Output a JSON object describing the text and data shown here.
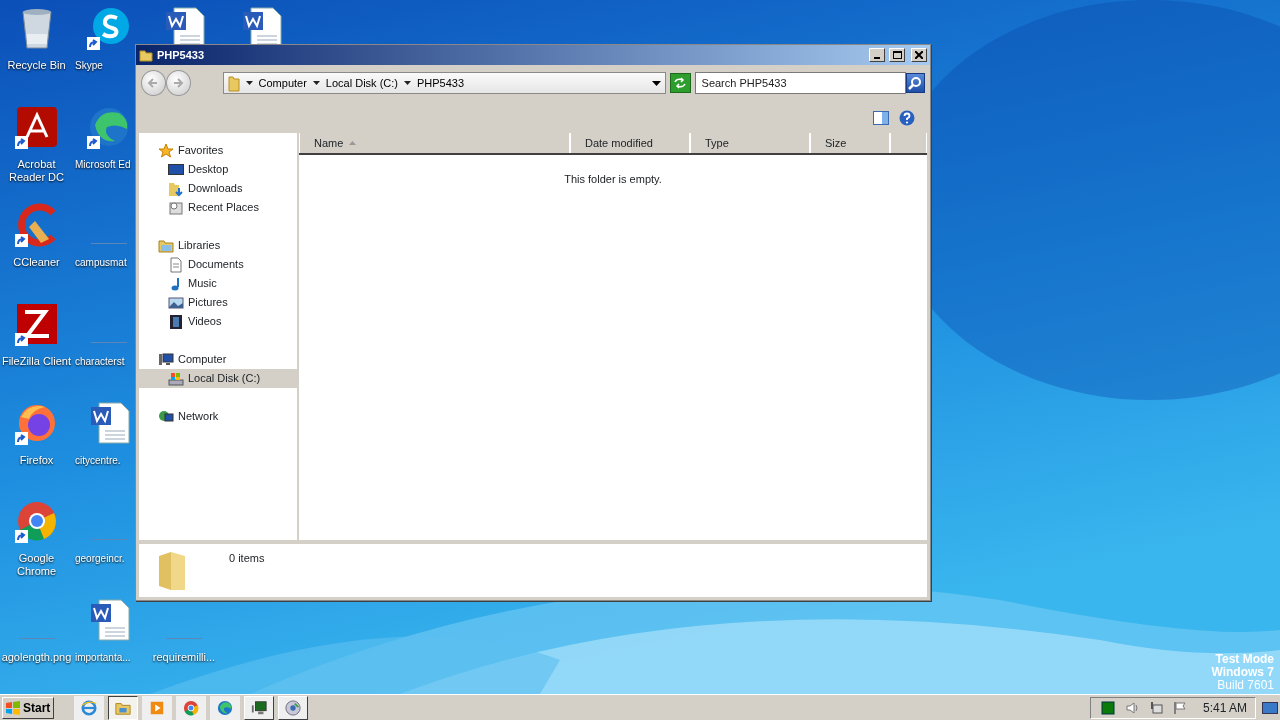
{
  "desktop": {
    "columns": [
      [
        {
          "label": "Recycle Bin",
          "kind": "recycle",
          "shortcut": false
        },
        {
          "label": "Acrobat Reader DC",
          "kind": "acrobat",
          "shortcut": true
        },
        {
          "label": "CCleaner",
          "kind": "ccleaner",
          "shortcut": true
        },
        {
          "label": "FileZilla Client",
          "kind": "filezilla",
          "shortcut": true
        },
        {
          "label": "Firefox",
          "kind": "firefox",
          "shortcut": true
        },
        {
          "label": "Google Chrome",
          "kind": "chrome",
          "shortcut": true
        },
        {
          "label": "agolength.png",
          "kind": "blank",
          "shortcut": false
        }
      ],
      [
        {
          "label": "Skype",
          "kind": "skype",
          "shortcut": true
        },
        {
          "label": "Microsoft Ed",
          "kind": "edge",
          "shortcut": true
        },
        {
          "label": "campusmat",
          "kind": "blank",
          "shortcut": false
        },
        {
          "label": "characterst",
          "kind": "blank",
          "shortcut": false
        },
        {
          "label": "citycentre.",
          "kind": "word",
          "shortcut": false
        },
        {
          "label": "georgeincr.",
          "kind": "blank",
          "shortcut": false
        },
        {
          "label": "importanta...",
          "kind": "word",
          "shortcut": false
        }
      ],
      [
        {
          "kind": "word",
          "shortcut": false
        },
        {
          "label": "requiremilli...",
          "kind": "blank",
          "shortcut": false
        }
      ],
      [
        {
          "kind": "word",
          "shortcut": false
        }
      ]
    ]
  },
  "os_notice": [
    {
      "text": "Test Mode",
      "bold": true
    },
    {
      "text": "Windows 7",
      "bold": true
    },
    {
      "text": "Build 7601",
      "bold": false
    }
  ],
  "window": {
    "title": "PHP5433",
    "breadcrumb": [
      "Computer",
      "Local Disk (C:)",
      "PHP5433"
    ],
    "search": {
      "placeholder": "Search PHP5433"
    },
    "nav_pane": [
      {
        "label": "Favorites",
        "kind": "star",
        "selected": false,
        "children": [
          {
            "label": "Desktop",
            "kind": "desktop",
            "selected": false
          },
          {
            "label": "Downloads",
            "kind": "downloads",
            "selected": false
          },
          {
            "label": "Recent Places",
            "kind": "recent",
            "selected": false
          }
        ]
      },
      {
        "label": "Libraries",
        "kind": "libraries",
        "selected": false,
        "children": [
          {
            "label": "Documents",
            "kind": "documents",
            "selected": false
          },
          {
            "label": "Music",
            "kind": "music",
            "selected": false
          },
          {
            "label": "Pictures",
            "kind": "pictures",
            "selected": false
          },
          {
            "label": "Videos",
            "kind": "videos",
            "selected": false
          }
        ]
      },
      {
        "label": "Computer",
        "kind": "computer",
        "selected": false,
        "children": [
          {
            "label": "Local Disk (C:)",
            "kind": "disk",
            "selected": true
          }
        ]
      },
      {
        "label": "Network",
        "kind": "network",
        "selected": false
      }
    ],
    "columns": [
      {
        "label": "Name",
        "sorted": true
      },
      {
        "label": "Date modified",
        "sorted": false
      },
      {
        "label": "Type",
        "sorted": false
      },
      {
        "label": "Size",
        "sorted": false
      }
    ],
    "empty_message": "This folder is empty.",
    "status": "0 items"
  },
  "taskbar": {
    "start": "Start",
    "items": [
      {
        "kind": "ie",
        "running": false,
        "active": false
      },
      {
        "kind": "explorer",
        "running": true,
        "active": true
      },
      {
        "kind": "media",
        "running": false,
        "active": false
      },
      {
        "kind": "chrome",
        "running": false,
        "active": false
      },
      {
        "kind": "edge",
        "running": false,
        "active": false
      },
      {
        "kind": "monitor",
        "running": true,
        "active": false
      },
      {
        "kind": "disc",
        "running": true,
        "active": false
      }
    ],
    "tray": [
      {
        "kind": "status"
      },
      {
        "kind": "volume"
      },
      {
        "kind": "network"
      },
      {
        "kind": "flag"
      }
    ],
    "clock": "5:41 AM"
  }
}
